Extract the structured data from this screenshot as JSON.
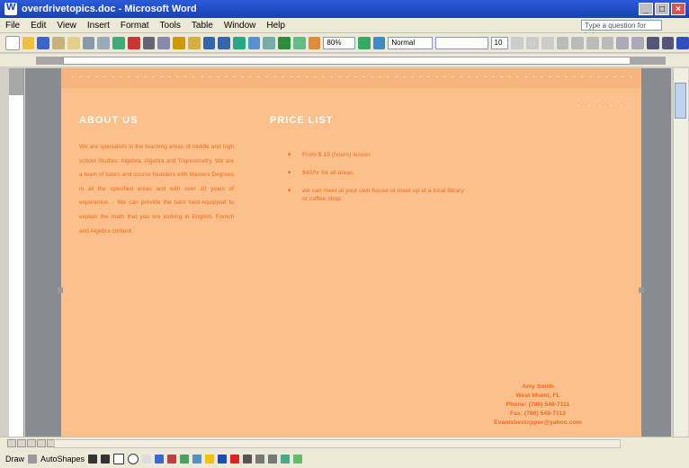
{
  "window": {
    "title": "overdrivetopics.doc - Microsoft Word",
    "controls": [
      "minimize",
      "maximize",
      "close"
    ]
  },
  "menu": {
    "items": [
      "File",
      "Edit",
      "View",
      "Insert",
      "Format",
      "Tools",
      "Table",
      "Window",
      "Help"
    ],
    "help_placeholder": "Type a question for help"
  },
  "toolbar": {
    "zoom": "80%",
    "style": "Normal",
    "font_size": "10"
  },
  "document": {
    "about_heading": "ABOUT US",
    "about_text": "We are specialists in the teaching areas of middle and high school Studies: Algebra, Algebra and Trigonometry. We are a team of tutors and course founders with Masters Degrees in all the specified areas and with over 10 years of experience. - We can provide the tutor best-equipped to explain the math that you are looking in English, French and Algebra content.",
    "price_heading": "PRICE LIST",
    "price_items": [
      "From $ 15 (hours) lesson",
      "$40/hr for all areas",
      "we can meet at your own house or meet up at a local library or coffee shop"
    ],
    "contact": {
      "name": "Amy Smith",
      "city": "West Miami, FL",
      "phone": "Phone: (786) 548-7111",
      "fax": "Fax: (786) 548-7112",
      "email": "Evanisbestoppor@yahoo.com"
    }
  },
  "drawbar": {
    "draw_label": "Draw",
    "autoshapes_label": "AutoShapes"
  },
  "colors": {
    "page_background": "#fbc08c",
    "accent_text": "#f26b1d",
    "heading_text": "#ffffff",
    "titlebar": "#1941b8"
  }
}
